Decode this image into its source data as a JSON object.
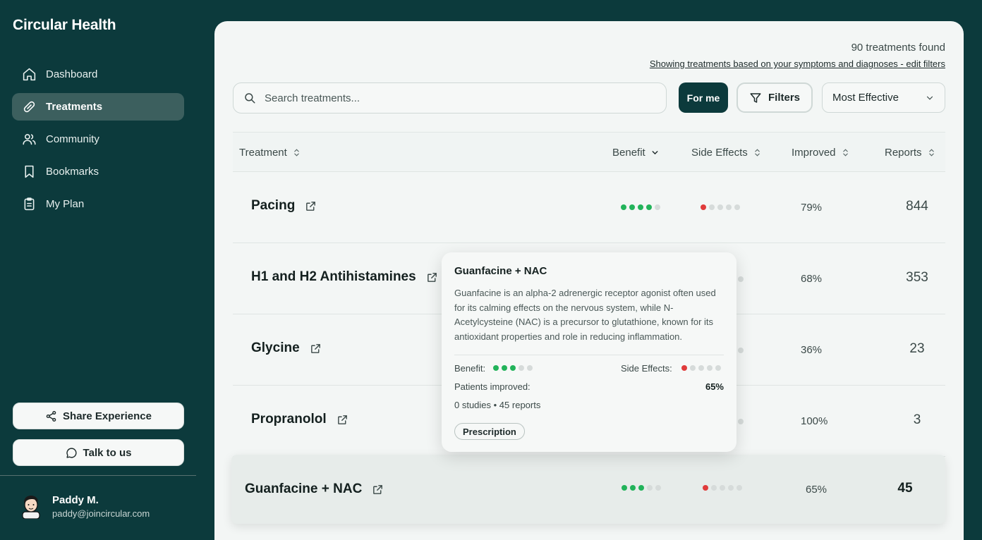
{
  "app": {
    "title": "Circular Health"
  },
  "sidebar": {
    "items": [
      {
        "label": "Dashboard",
        "icon": "home-icon",
        "active": false
      },
      {
        "label": "Treatments",
        "icon": "pill-icon",
        "active": true
      },
      {
        "label": "Community",
        "icon": "users-icon",
        "active": false
      },
      {
        "label": "Bookmarks",
        "icon": "bookmark-icon",
        "active": false
      },
      {
        "label": "My Plan",
        "icon": "clipboard-icon",
        "active": false
      }
    ],
    "share_label": "Share Experience",
    "talk_label": "Talk to us",
    "user": {
      "name": "Paddy M.",
      "email": "paddy@joincircular.com"
    }
  },
  "header": {
    "count_text": "90 treatments found",
    "filter_link": "Showing treatments based on your symptoms and diagnoses - edit filters"
  },
  "toolbar": {
    "search_placeholder": "Search treatments...",
    "for_me_label": "For me",
    "filters_label": "Filters",
    "sort_value": "Most Effective"
  },
  "table": {
    "columns": [
      "Treatment",
      "Benefit",
      "Side Effects",
      "Improved",
      "Reports"
    ],
    "rows": [
      {
        "name": "Pacing",
        "benefit": 4,
        "side_effects": 1,
        "improved": "79%",
        "reports": "844"
      },
      {
        "name": "H1 and H2 Antihistamines",
        "benefit": null,
        "side_effects": null,
        "improved": "68%",
        "reports": "353"
      },
      {
        "name": "Glycine",
        "benefit": null,
        "side_effects": null,
        "improved": "36%",
        "reports": "23"
      },
      {
        "name": "Propranolol",
        "benefit": null,
        "side_effects": null,
        "improved": "100%",
        "reports": "3"
      },
      {
        "name": "Guanfacine + NAC",
        "benefit": 3,
        "side_effects": 1,
        "improved": "65%",
        "reports": "45"
      }
    ]
  },
  "tooltip": {
    "title": "Guanfacine + NAC",
    "description": "Guanfacine is an alpha-2 adrenergic receptor agonist often used for its calming effects on the nervous system, while N-Acetylcysteine (NAC) is a precursor to glutathione, known for its antioxidant properties and role in reducing inflammation.",
    "benefit_label": "Benefit:",
    "benefit": 3,
    "side_effects_label": "Side Effects:",
    "side_effects": 1,
    "patients_label": "Patients improved:",
    "patients_value": "65%",
    "studies_text": "0 studies • 45 reports",
    "tag": "Prescription"
  },
  "colors": {
    "sidebar_bg": "#0c3a3c",
    "benefit_dot": "#22b35a",
    "side_effect_dot": "#e03b3b",
    "empty_dot": "#d6dbda"
  }
}
